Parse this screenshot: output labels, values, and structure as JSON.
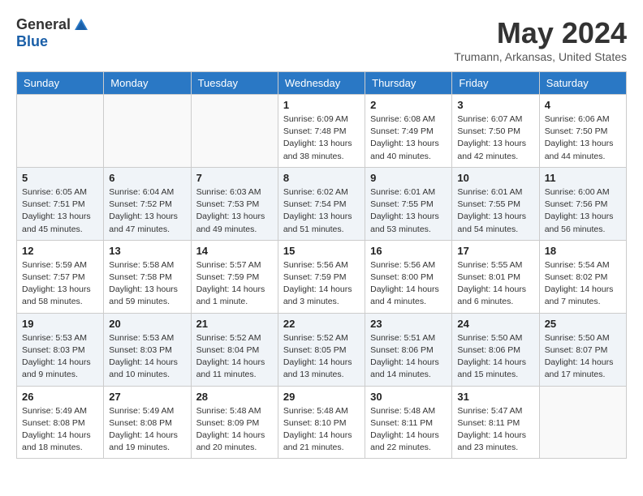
{
  "header": {
    "logo_general": "General",
    "logo_blue": "Blue",
    "title": "May 2024",
    "location": "Trumann, Arkansas, United States"
  },
  "weekdays": [
    "Sunday",
    "Monday",
    "Tuesday",
    "Wednesday",
    "Thursday",
    "Friday",
    "Saturday"
  ],
  "weeks": [
    [
      {
        "day": "",
        "info": ""
      },
      {
        "day": "",
        "info": ""
      },
      {
        "day": "",
        "info": ""
      },
      {
        "day": "1",
        "info": "Sunrise: 6:09 AM\nSunset: 7:48 PM\nDaylight: 13 hours\nand 38 minutes."
      },
      {
        "day": "2",
        "info": "Sunrise: 6:08 AM\nSunset: 7:49 PM\nDaylight: 13 hours\nand 40 minutes."
      },
      {
        "day": "3",
        "info": "Sunrise: 6:07 AM\nSunset: 7:50 PM\nDaylight: 13 hours\nand 42 minutes."
      },
      {
        "day": "4",
        "info": "Sunrise: 6:06 AM\nSunset: 7:50 PM\nDaylight: 13 hours\nand 44 minutes."
      }
    ],
    [
      {
        "day": "5",
        "info": "Sunrise: 6:05 AM\nSunset: 7:51 PM\nDaylight: 13 hours\nand 45 minutes."
      },
      {
        "day": "6",
        "info": "Sunrise: 6:04 AM\nSunset: 7:52 PM\nDaylight: 13 hours\nand 47 minutes."
      },
      {
        "day": "7",
        "info": "Sunrise: 6:03 AM\nSunset: 7:53 PM\nDaylight: 13 hours\nand 49 minutes."
      },
      {
        "day": "8",
        "info": "Sunrise: 6:02 AM\nSunset: 7:54 PM\nDaylight: 13 hours\nand 51 minutes."
      },
      {
        "day": "9",
        "info": "Sunrise: 6:01 AM\nSunset: 7:55 PM\nDaylight: 13 hours\nand 53 minutes."
      },
      {
        "day": "10",
        "info": "Sunrise: 6:01 AM\nSunset: 7:55 PM\nDaylight: 13 hours\nand 54 minutes."
      },
      {
        "day": "11",
        "info": "Sunrise: 6:00 AM\nSunset: 7:56 PM\nDaylight: 13 hours\nand 56 minutes."
      }
    ],
    [
      {
        "day": "12",
        "info": "Sunrise: 5:59 AM\nSunset: 7:57 PM\nDaylight: 13 hours\nand 58 minutes."
      },
      {
        "day": "13",
        "info": "Sunrise: 5:58 AM\nSunset: 7:58 PM\nDaylight: 13 hours\nand 59 minutes."
      },
      {
        "day": "14",
        "info": "Sunrise: 5:57 AM\nSunset: 7:59 PM\nDaylight: 14 hours\nand 1 minute."
      },
      {
        "day": "15",
        "info": "Sunrise: 5:56 AM\nSunset: 7:59 PM\nDaylight: 14 hours\nand 3 minutes."
      },
      {
        "day": "16",
        "info": "Sunrise: 5:56 AM\nSunset: 8:00 PM\nDaylight: 14 hours\nand 4 minutes."
      },
      {
        "day": "17",
        "info": "Sunrise: 5:55 AM\nSunset: 8:01 PM\nDaylight: 14 hours\nand 6 minutes."
      },
      {
        "day": "18",
        "info": "Sunrise: 5:54 AM\nSunset: 8:02 PM\nDaylight: 14 hours\nand 7 minutes."
      }
    ],
    [
      {
        "day": "19",
        "info": "Sunrise: 5:53 AM\nSunset: 8:03 PM\nDaylight: 14 hours\nand 9 minutes."
      },
      {
        "day": "20",
        "info": "Sunrise: 5:53 AM\nSunset: 8:03 PM\nDaylight: 14 hours\nand 10 minutes."
      },
      {
        "day": "21",
        "info": "Sunrise: 5:52 AM\nSunset: 8:04 PM\nDaylight: 14 hours\nand 11 minutes."
      },
      {
        "day": "22",
        "info": "Sunrise: 5:52 AM\nSunset: 8:05 PM\nDaylight: 14 hours\nand 13 minutes."
      },
      {
        "day": "23",
        "info": "Sunrise: 5:51 AM\nSunset: 8:06 PM\nDaylight: 14 hours\nand 14 minutes."
      },
      {
        "day": "24",
        "info": "Sunrise: 5:50 AM\nSunset: 8:06 PM\nDaylight: 14 hours\nand 15 minutes."
      },
      {
        "day": "25",
        "info": "Sunrise: 5:50 AM\nSunset: 8:07 PM\nDaylight: 14 hours\nand 17 minutes."
      }
    ],
    [
      {
        "day": "26",
        "info": "Sunrise: 5:49 AM\nSunset: 8:08 PM\nDaylight: 14 hours\nand 18 minutes."
      },
      {
        "day": "27",
        "info": "Sunrise: 5:49 AM\nSunset: 8:08 PM\nDaylight: 14 hours\nand 19 minutes."
      },
      {
        "day": "28",
        "info": "Sunrise: 5:48 AM\nSunset: 8:09 PM\nDaylight: 14 hours\nand 20 minutes."
      },
      {
        "day": "29",
        "info": "Sunrise: 5:48 AM\nSunset: 8:10 PM\nDaylight: 14 hours\nand 21 minutes."
      },
      {
        "day": "30",
        "info": "Sunrise: 5:48 AM\nSunset: 8:11 PM\nDaylight: 14 hours\nand 22 minutes."
      },
      {
        "day": "31",
        "info": "Sunrise: 5:47 AM\nSunset: 8:11 PM\nDaylight: 14 hours\nand 23 minutes."
      },
      {
        "day": "",
        "info": ""
      }
    ]
  ]
}
